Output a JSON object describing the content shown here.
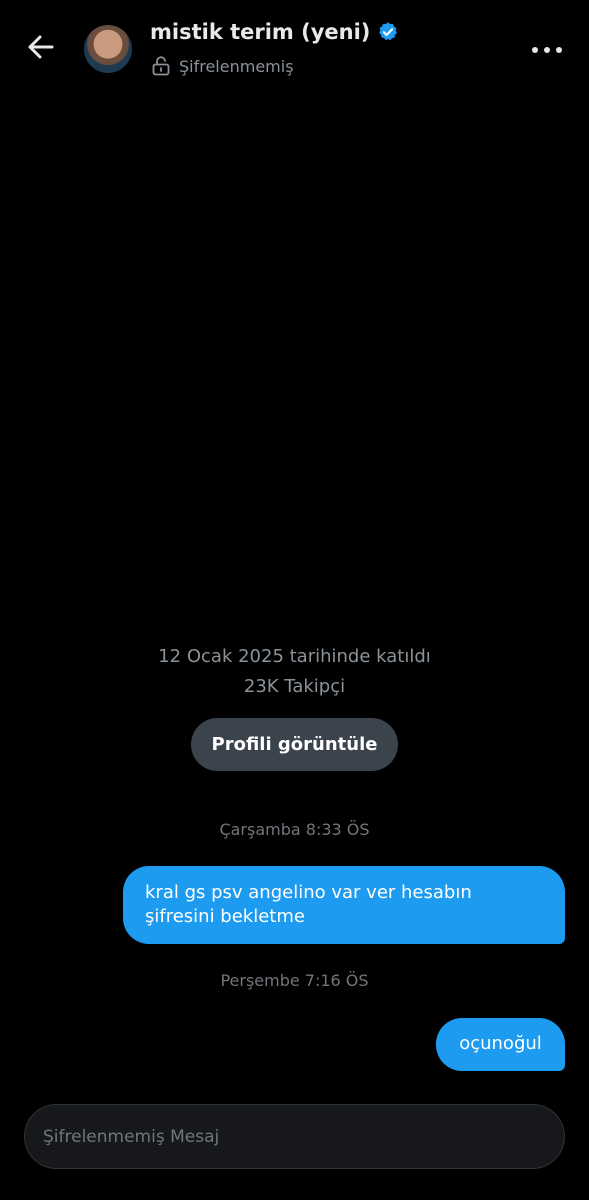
{
  "header": {
    "name": "mistik terim (yeni)",
    "encryption_status": "Şifrelenmemiş",
    "back_icon": "arrow-left-icon",
    "verified_icon": "verified-badge-icon",
    "lock_icon": "unlocked-lock-icon",
    "more_icon": "more-horizontal-icon"
  },
  "profile": {
    "joined": "12 Ocak 2025 tarihinde katıldı",
    "followers": "23K Takipçi",
    "view_profile_label": "Profili görüntüle"
  },
  "messages": [
    {
      "timestamp": "Çarşamba 8:33 ÖS",
      "text": "kral gs psv angelino var ver hesabın şifresini bekletme",
      "sender": "me"
    },
    {
      "timestamp": "Perşembe 7:16 ÖS",
      "text": "oçunoğul",
      "sender": "me"
    }
  ],
  "composer": {
    "placeholder": "Şifrelenmemiş Mesaj"
  },
  "colors": {
    "background": "#000000",
    "bubble": "#1d9bf0",
    "verified": "#1d9bf0",
    "button": "#3b444c",
    "muted_text": "#71767b"
  }
}
